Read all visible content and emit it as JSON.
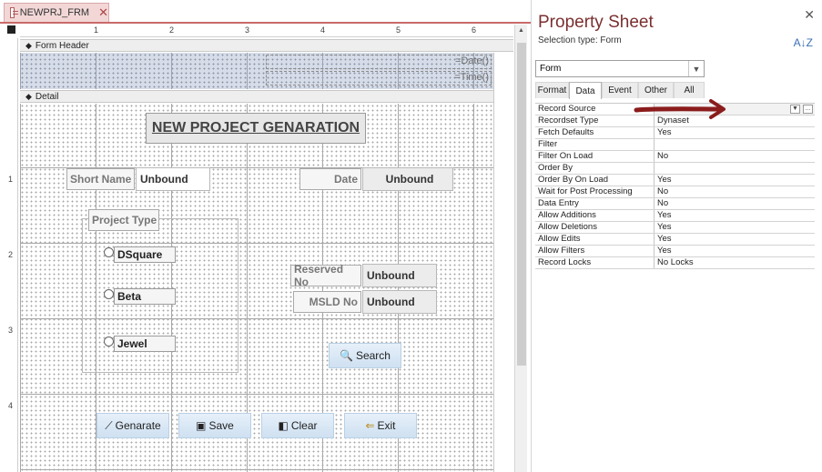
{
  "doc_tab": {
    "label": "NEWPRJ_FRM",
    "icon": "form-icon",
    "close_icon": "close-icon"
  },
  "ruler": {
    "top_marks": [
      "1",
      "2",
      "3",
      "4",
      "5",
      "6"
    ],
    "left_marks": [
      "1",
      "2",
      "3",
      "4"
    ]
  },
  "sections": {
    "form_header": "Form Header",
    "detail": "Detail"
  },
  "header_controls": {
    "date_expr": "=Date()",
    "time_expr": "=Time()"
  },
  "form": {
    "title": "NEW PROJECT GENARATION",
    "short_name_label": "Short Name",
    "short_name_value": "Unbound",
    "date_label": "Date",
    "date_value": "Unbound",
    "project_type_label": "Project Type",
    "options": [
      "DSquare",
      "Beta",
      "Jewel"
    ],
    "reserved_no_label": "Reserved No",
    "reserved_no_value": "Unbound",
    "msld_no_label": "MSLD No",
    "msld_no_value": "Unbound",
    "search_button": "Search",
    "buttons": {
      "generate": "Genarate",
      "save": "Save",
      "clear": "Clear",
      "exit": "Exit"
    }
  },
  "property_sheet": {
    "title": "Property Sheet",
    "selection_type": "Selection type:  Form",
    "object_combo": "Form",
    "tabs": [
      "Format",
      "Data",
      "Event",
      "Other",
      "All"
    ],
    "active_tab": "Data",
    "rows": [
      {
        "name": "Record Source",
        "value": ""
      },
      {
        "name": "Recordset Type",
        "value": "Dynaset"
      },
      {
        "name": "Fetch Defaults",
        "value": "Yes"
      },
      {
        "name": "Filter",
        "value": ""
      },
      {
        "name": "Filter On Load",
        "value": "No"
      },
      {
        "name": "Order By",
        "value": ""
      },
      {
        "name": "Order By On Load",
        "value": "Yes"
      },
      {
        "name": "Wait for Post Processing",
        "value": "No"
      },
      {
        "name": "Data Entry",
        "value": "No"
      },
      {
        "name": "Allow Additions",
        "value": "Yes"
      },
      {
        "name": "Allow Deletions",
        "value": "Yes"
      },
      {
        "name": "Allow Edits",
        "value": "Yes"
      },
      {
        "name": "Allow Filters",
        "value": "Yes"
      },
      {
        "name": "Record Locks",
        "value": "No Locks"
      }
    ],
    "builder_button": "...",
    "annotation_color": "#8b1c1c"
  }
}
